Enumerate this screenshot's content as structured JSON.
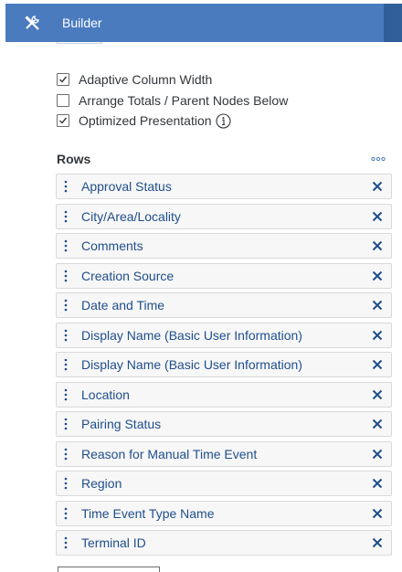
{
  "header": {
    "title": "Builder",
    "icon": "tools-icon"
  },
  "options": [
    {
      "label": "Adaptive Column Width",
      "checked": true
    },
    {
      "label": "Arrange Totals / Parent Nodes Below",
      "checked": false
    },
    {
      "label": "Optimized Presentation",
      "checked": true,
      "info": true
    }
  ],
  "rows": {
    "title": "Rows",
    "items": [
      "Approval Status",
      "City/Area/Locality",
      "Comments",
      "Creation Source",
      "Date and Time",
      "Display Name (Basic User Information)",
      "Display Name (Basic User Information)",
      "Location",
      "Pairing Status",
      "Reason for Manual Time Event",
      "Region",
      "Time Event Type Name",
      "Terminal ID"
    ]
  },
  "colors": {
    "header": "#4a7bbf",
    "header_edge": "#2f5e99",
    "link": "#1f4e8c"
  }
}
